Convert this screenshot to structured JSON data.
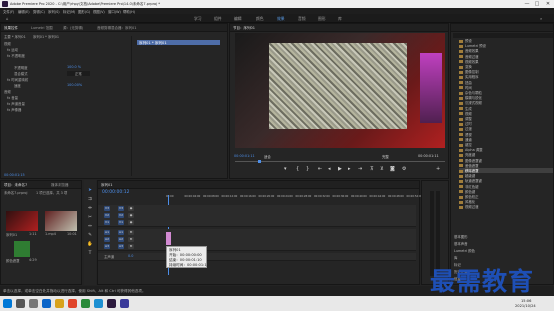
{
  "window": {
    "title": "Adobe Premiere Pro 2020 - C:\\用户\\rhpy\\文档\\Adobe\\Premiere Pro\\14.0\\未命名7.prproj *",
    "minimize": "—",
    "maximize": "□",
    "close": "✕"
  },
  "menu": [
    "文件(F)",
    "编辑(E)",
    "剪辑(C)",
    "序列(S)",
    "标记(M)",
    "图形(G)",
    "视图(V)",
    "窗口(W)",
    "帮助(H)"
  ],
  "workspaces": [
    "学习",
    "组件",
    "编辑",
    "颜色",
    "效果",
    "音频",
    "图形",
    "库"
  ],
  "active_workspace": "效果",
  "effect_controls": {
    "tabs": [
      "效果控件",
      "Lumetri 范围",
      "源：(无剪辑)",
      "音频剪辑混合器：序列01"
    ],
    "source_label": "主要 * 序列01",
    "clip_label": "序列01 * 序列01",
    "video_header": "视频",
    "rows": [
      {
        "label": "fx  运动"
      },
      {
        "label": "fx  不透明度"
      },
      {
        "label": "不透明度",
        "value": "100.0 %"
      },
      {
        "label": "混合模式",
        "value": "正常"
      },
      {
        "label": "fx  时间重映射"
      },
      {
        "label": "速度",
        "value": "100.00%"
      }
    ],
    "audio_header": "音频",
    "audio_rows": [
      "fx  音量",
      "fx  声道音量",
      "fx  声像器"
    ],
    "time": "00:00:01:15"
  },
  "program_monitor": {
    "title": "节目：序列01",
    "timecode": "00:00:01:11",
    "fit": "适合",
    "quality": "完整",
    "duration": "00:00:01:11"
  },
  "project": {
    "tabs": [
      "项目：未命名7",
      "媒体浏览器"
    ],
    "path": "未命名7.prproj",
    "count": "1 项已选择，共 3 项",
    "items": [
      {
        "name": "序列01",
        "duration": "1:11"
      },
      {
        "name": "1.mp4",
        "duration": "10:01"
      },
      {
        "name": "颜色遮罩",
        "duration": "4:29"
      }
    ]
  },
  "timeline": {
    "title": "序列01",
    "timecode": "00:00:00:12",
    "ruler": [
      "00:00",
      "00:00:04:00",
      "00:00:08:00",
      "00:00:12:00",
      "00:00:16:00",
      "00:00:20:00",
      "00:00:24:00",
      "00:00:28:00",
      "00:00:32:00",
      "00:00:36:00",
      "00:00:40:00",
      "00:00:44:00",
      "00:00:48:00",
      "00:00:52:00"
    ],
    "video_tracks": [
      "V3",
      "V2",
      "V1"
    ],
    "audio_tracks": [
      "A1",
      "A2",
      "A3"
    ],
    "master": "主声道",
    "master_value": "0.0",
    "tooltip_lines": [
      "序列01",
      "开始：00:00:00:00",
      "结束：00:00:01:10",
      "持续时间：00:00:01:11"
    ]
  },
  "effects_panel": {
    "tree": [
      {
        "label": "预设",
        "sel": false
      },
      {
        "label": "Lumetri 预设",
        "sel": false
      },
      {
        "label": "音频效果",
        "sel": false
      },
      {
        "label": "音频过渡",
        "sel": false
      },
      {
        "label": "视频效果",
        "sel": false
      },
      {
        "label": "变换",
        "sel": false
      },
      {
        "label": "图像控制",
        "sel": false
      },
      {
        "label": "实用程序",
        "sel": false
      },
      {
        "label": "扭曲",
        "sel": false
      },
      {
        "label": "时间",
        "sel": false
      },
      {
        "label": "杂色与颗粒",
        "sel": false
      },
      {
        "label": "模糊与锐化",
        "sel": false
      },
      {
        "label": "沉浸式视频",
        "sel": false
      },
      {
        "label": "生成",
        "sel": false
      },
      {
        "label": "视频",
        "sel": false
      },
      {
        "label": "调整",
        "sel": false
      },
      {
        "label": "过时",
        "sel": false
      },
      {
        "label": "过渡",
        "sel": false
      },
      {
        "label": "透视",
        "sel": false
      },
      {
        "label": "通道",
        "sel": false
      },
      {
        "label": "键控",
        "sel": false
      },
      {
        "label": "Alpha 调整",
        "sel": false
      },
      {
        "label": "亮度键",
        "sel": false
      },
      {
        "label": "图像遮罩键",
        "sel": false
      },
      {
        "label": "差值遮罩",
        "sel": false
      },
      {
        "label": "移除遮罩",
        "sel": true
      },
      {
        "label": "超级键",
        "sel": false
      },
      {
        "label": "轨道遮罩键",
        "sel": false
      },
      {
        "label": "非红色键",
        "sel": false
      },
      {
        "label": "颜色键",
        "sel": false
      },
      {
        "label": "颜色校正",
        "sel": false
      },
      {
        "label": "风格化",
        "sel": false
      },
      {
        "label": "视频过渡",
        "sel": false
      }
    ],
    "bottom_items": [
      "基本图形",
      "基本声音",
      "Lumetri 颜色",
      "库",
      "标记",
      "历史记录",
      "信息"
    ]
  },
  "status_bar": "单击以选择，或单击空白处并拖动以进行选择，使用 Shift、Alt 和 Ctrl 可获得其他选项。",
  "taskbar": {
    "time": "15:06",
    "date": "2021/10/24"
  },
  "watermark": "最需教育"
}
